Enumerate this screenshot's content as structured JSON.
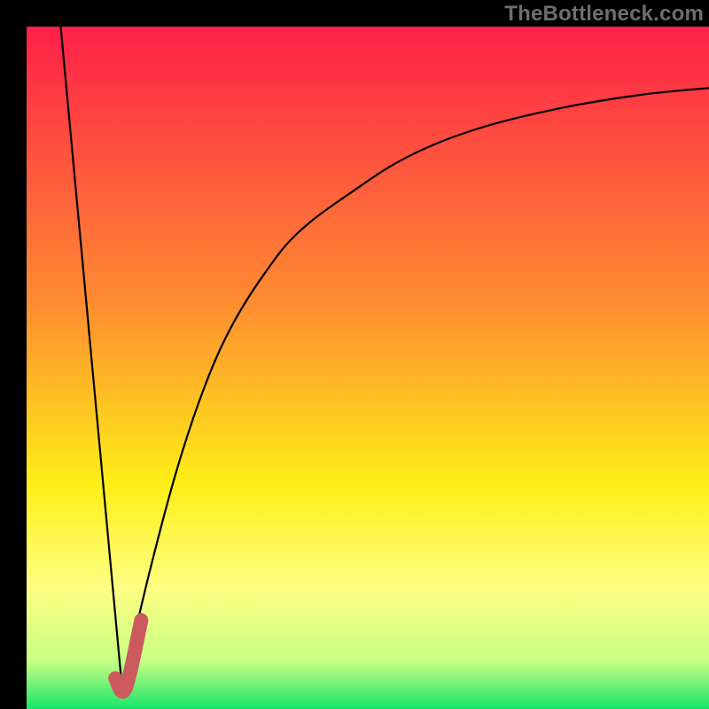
{
  "watermark": "TheBottleneck.com",
  "chart_data": {
    "type": "line",
    "title": "",
    "xlabel": "",
    "ylabel": "",
    "xlim": [
      0,
      100
    ],
    "ylim": [
      0,
      100
    ],
    "grid": false,
    "legend": false,
    "gradient_colors": {
      "top": "#fe2049",
      "mid1": "#fe8b32",
      "mid2": "#fdee17",
      "mid3": "#feff82",
      "mid4": "#c8ff85",
      "bottom": "#17e668"
    },
    "series": [
      {
        "name": "left-descent",
        "x": [
          5,
          14
        ],
        "y": [
          100,
          3
        ],
        "color": "#000000"
      },
      {
        "name": "right-ascent",
        "x": [
          14,
          18,
          22,
          26,
          30,
          35,
          40,
          48,
          56,
          66,
          78,
          90,
          100
        ],
        "y": [
          3,
          20,
          35,
          47,
          56,
          64,
          70,
          76,
          81,
          85,
          88,
          90,
          91
        ],
        "color": "#000000"
      }
    ],
    "highlight_segment": {
      "name": "minimum-marker",
      "x": [
        13,
        14.5,
        16.8
      ],
      "y": [
        4.5,
        3,
        13
      ],
      "color": "#cb5a5f"
    }
  }
}
